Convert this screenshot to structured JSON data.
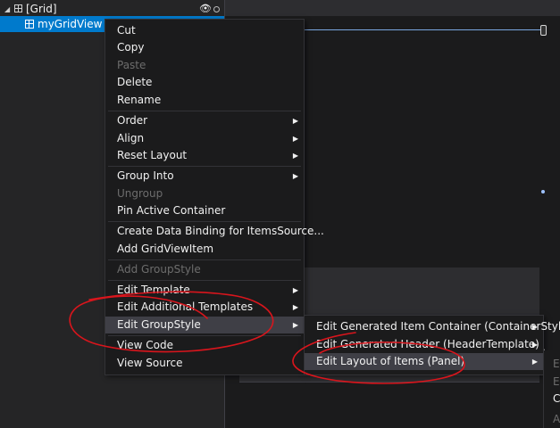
{
  "tree": {
    "grid_label": "[Grid]",
    "selected_label": "myGridView"
  },
  "context_menu": {
    "items": [
      {
        "label": "Cut"
      },
      {
        "label": "Copy"
      },
      {
        "label": "Paste"
      },
      {
        "label": "Delete"
      },
      {
        "label": "Rename"
      },
      {
        "label": "Order"
      },
      {
        "label": "Align"
      },
      {
        "label": "Reset Layout"
      },
      {
        "label": "Group Into"
      },
      {
        "label": "Ungroup"
      },
      {
        "label": "Pin Active Container"
      },
      {
        "label": "Create Data Binding for ItemsSource..."
      },
      {
        "label": "Add GridViewItem"
      },
      {
        "label": "Add GroupStyle"
      },
      {
        "label": "Edit Template"
      },
      {
        "label": "Edit Additional Templates"
      },
      {
        "label": "Edit GroupStyle"
      },
      {
        "label": "View Code"
      },
      {
        "label": "View Source"
      }
    ]
  },
  "submenu": {
    "items": [
      {
        "label": "Edit Generated Item Container (ContainerStyle)"
      },
      {
        "label": "Edit Generated Header (HeaderTemplate)"
      },
      {
        "label": "Edit Layout of Items (Panel)"
      }
    ]
  },
  "third_menu": {
    "items": [
      {
        "label": "Ec"
      },
      {
        "label": "Ec"
      },
      {
        "label": "Cr"
      },
      {
        "label": "Ap"
      }
    ]
  },
  "colors": {
    "selection": "#007acc",
    "menu_bg": "#1b1b1c",
    "hover": "#3f3f46",
    "annotation": "#d9151c"
  }
}
